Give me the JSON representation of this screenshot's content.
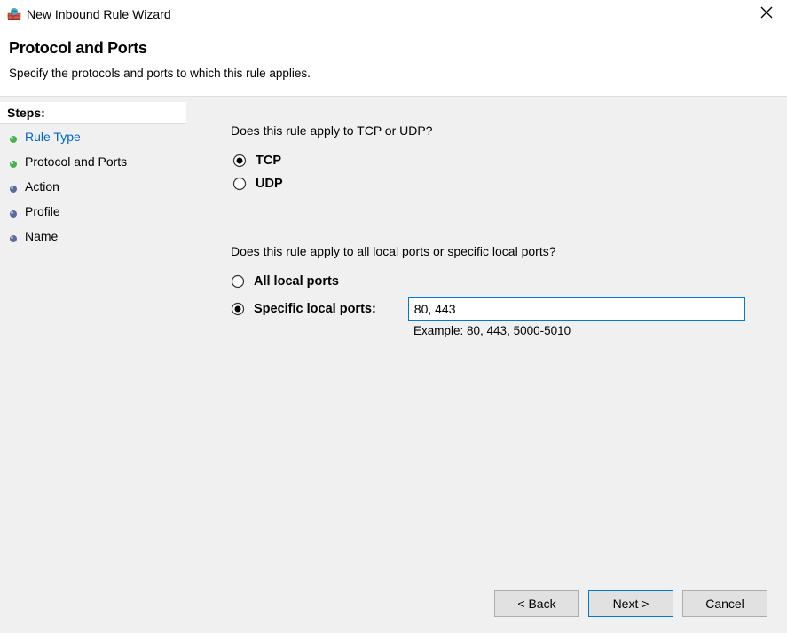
{
  "titlebar": {
    "title": "New Inbound Rule Wizard"
  },
  "header": {
    "title": "Protocol and Ports",
    "subtitle": "Specify the protocols and ports to which this rule applies."
  },
  "sidebar": {
    "heading": "Steps:",
    "items": [
      {
        "label": "Rule Type",
        "completed": true,
        "current": true
      },
      {
        "label": "Protocol and Ports",
        "completed": true,
        "current": false
      },
      {
        "label": "Action",
        "completed": false,
        "current": false
      },
      {
        "label": "Profile",
        "completed": false,
        "current": false
      },
      {
        "label": "Name",
        "completed": false,
        "current": false
      }
    ]
  },
  "main": {
    "question1": "Does this rule apply to TCP or UDP?",
    "protocol": {
      "tcp_label": "TCP",
      "udp_label": "UDP",
      "selected": "tcp"
    },
    "question2": "Does this rule apply to all local ports or specific local ports?",
    "ports": {
      "all_label": "All local ports",
      "specific_label": "Specific local ports:",
      "selected": "specific",
      "value": "80, 443",
      "example": "Example: 80, 443, 5000-5010"
    }
  },
  "buttons": {
    "back": "< Back",
    "next": "Next >",
    "cancel": "Cancel"
  }
}
